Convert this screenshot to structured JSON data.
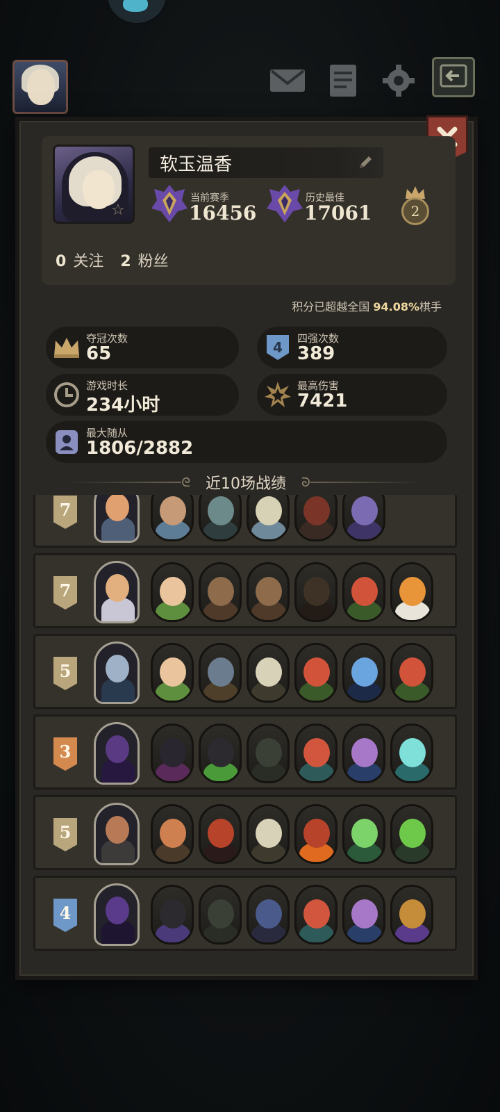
{
  "player": {
    "name": "软玉温香",
    "season_label": "当前赛季",
    "season_score": "16456",
    "best_label": "历史最佳",
    "best_score": "17061",
    "crown_level": "2",
    "following_count": "0",
    "following_label": "关注",
    "fans_count": "2",
    "fans_label": "粉丝",
    "percentile_prefix": "积分已超越全国",
    "percentile_value": "94.08%",
    "percentile_suffix": "棋手"
  },
  "stats": {
    "wins_label": "夺冠次数",
    "wins_value": "65",
    "top4_label": "四强次数",
    "top4_value": "389",
    "top4_icon_text": "4",
    "playtime_label": "游戏时长",
    "playtime_value": "234小时",
    "maxdmg_label": "最高伤害",
    "maxdmg_value": "7421",
    "followers_label": "最大随从",
    "followers_value": "1806/2882"
  },
  "section_title": "近10场战绩",
  "icons": {
    "mail": "mail-icon",
    "notes": "notes-icon",
    "settings": "gear-icon",
    "exit": "exit-icon",
    "close": "close-icon",
    "edit": "pencil-icon",
    "crown": "crown-icon",
    "clock": "clock-icon",
    "explosion": "explosion-icon",
    "follower": "follower-icon"
  },
  "colors": {
    "badge_gold": "#b9a67d",
    "badge_bronze": "#d48a4f",
    "badge_blue": "#6e98c7",
    "accent": "#f0d9a0"
  },
  "battles": [
    {
      "place": "7",
      "badge": "#b9a67d",
      "hero": [
        "#e0a070",
        "#4f5f78"
      ],
      "units": [
        [
          "#c79a77",
          "#5d7d96"
        ],
        [
          "#6c8a8a",
          "#2f3d3f"
        ],
        [
          "#d7d2b5",
          "#6e8a9a"
        ],
        [
          "#7a3428",
          "#3a2a24"
        ],
        [
          "#7b6bb3",
          "#3e3466"
        ]
      ]
    },
    {
      "place": "7",
      "badge": "#b9a67d",
      "hero": [
        "#e1b07e",
        "#c9c6d6"
      ],
      "units": [
        [
          "#e9c49c",
          "#5e8f3e"
        ],
        [
          "#8d6b4b",
          "#4f3a2a"
        ],
        [
          "#8d6b4b",
          "#4f3a2a"
        ],
        [
          "#3e3226",
          "#221b16"
        ],
        [
          "#d0533a",
          "#3b5a2a"
        ],
        [
          "#e89438",
          "#e8e4da"
        ]
      ]
    },
    {
      "place": "5",
      "badge": "#b9a67d",
      "hero": [
        "#9eb1c6",
        "#2a3a4e"
      ],
      "units": [
        [
          "#e9c49c",
          "#5e8f3e"
        ],
        [
          "#6b7c8e",
          "#4e3f2a"
        ],
        [
          "#d8d2b8",
          "#3e3a2e"
        ],
        [
          "#d0533a",
          "#3b5a2a"
        ],
        [
          "#6aa5e0",
          "#1c2a48"
        ],
        [
          "#d0533a",
          "#3b5a2a"
        ]
      ]
    },
    {
      "place": "3",
      "badge": "#d48a4f",
      "hero": [
        "#5b3a84",
        "#26183e"
      ],
      "units": [
        [
          "#2a2630",
          "#5a2a5a"
        ],
        [
          "#2c2a2e",
          "#4a9a3a"
        ],
        [
          "#3a4036",
          "#2a2c26"
        ],
        [
          "#d2563e",
          "#2e5a5a"
        ],
        [
          "#a878c8",
          "#2a3e6a"
        ],
        [
          "#7fe0da",
          "#2a6a6a"
        ]
      ]
    },
    {
      "place": "5",
      "badge": "#b9a67d",
      "hero": [
        "#b87a56",
        "#3d3a3a"
      ],
      "units": [
        [
          "#cf8050",
          "#4a3a2a"
        ],
        [
          "#b7432a",
          "#2a1a1a"
        ],
        [
          "#d8d2b8",
          "#3e3a2e"
        ],
        [
          "#b7432a",
          "#e06a20"
        ],
        [
          "#7cd36a",
          "#2a5a3a"
        ],
        [
          "#6ec94a",
          "#2a3a2a"
        ]
      ]
    },
    {
      "place": "4",
      "badge": "#6e98c7",
      "hero": [
        "#5a3a8a",
        "#1e1630"
      ],
      "units": [
        [
          "#2c2a2e",
          "#4a3a7a"
        ],
        [
          "#3a4036",
          "#2a2c26"
        ],
        [
          "#4a5a8a",
          "#2a2a3e"
        ],
        [
          "#d2563e",
          "#2e5a5a"
        ],
        [
          "#a878c8",
          "#2a3e6a"
        ],
        [
          "#c58c3a",
          "#5a3a8a"
        ]
      ]
    }
  ]
}
